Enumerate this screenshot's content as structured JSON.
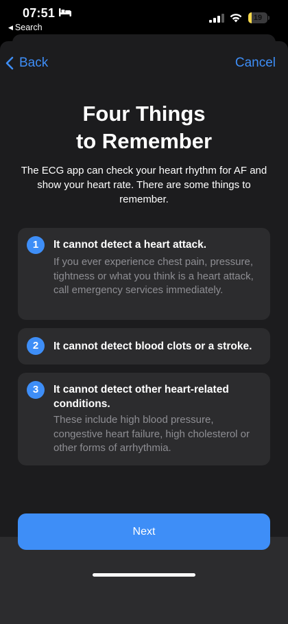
{
  "status_bar": {
    "time": "07:51",
    "back_app": "Search",
    "battery": "19",
    "battery_level": 0.19,
    "battery_color": "#f6d84a"
  },
  "nav": {
    "back_label": "Back",
    "cancel_label": "Cancel"
  },
  "title_line1": "Four Things",
  "title_line2": "to Remember",
  "intro": "The ECG app can check your heart rhythm for AF and show your heart rate. There are some things to remember.",
  "items": [
    {
      "number": "1",
      "title": "It cannot detect a heart attack.",
      "description": "If you ever experience chest pain, pressure, tightness or what you think is a heart attack, call emergency services immediately."
    },
    {
      "number": "2",
      "title": "It cannot detect blood clots or a stroke.",
      "description": ""
    },
    {
      "number": "3",
      "title": "It cannot detect other heart-related conditions.",
      "description": "These include high blood pressure, congestive heart failure, high cholesterol or other forms of arrhythmia."
    }
  ],
  "next_label": "Next",
  "colors": {
    "accent": "#3e8ef7",
    "sheet": "#1c1c1e",
    "card": "#2c2c2e",
    "secondary_text": "#8e8e93"
  }
}
